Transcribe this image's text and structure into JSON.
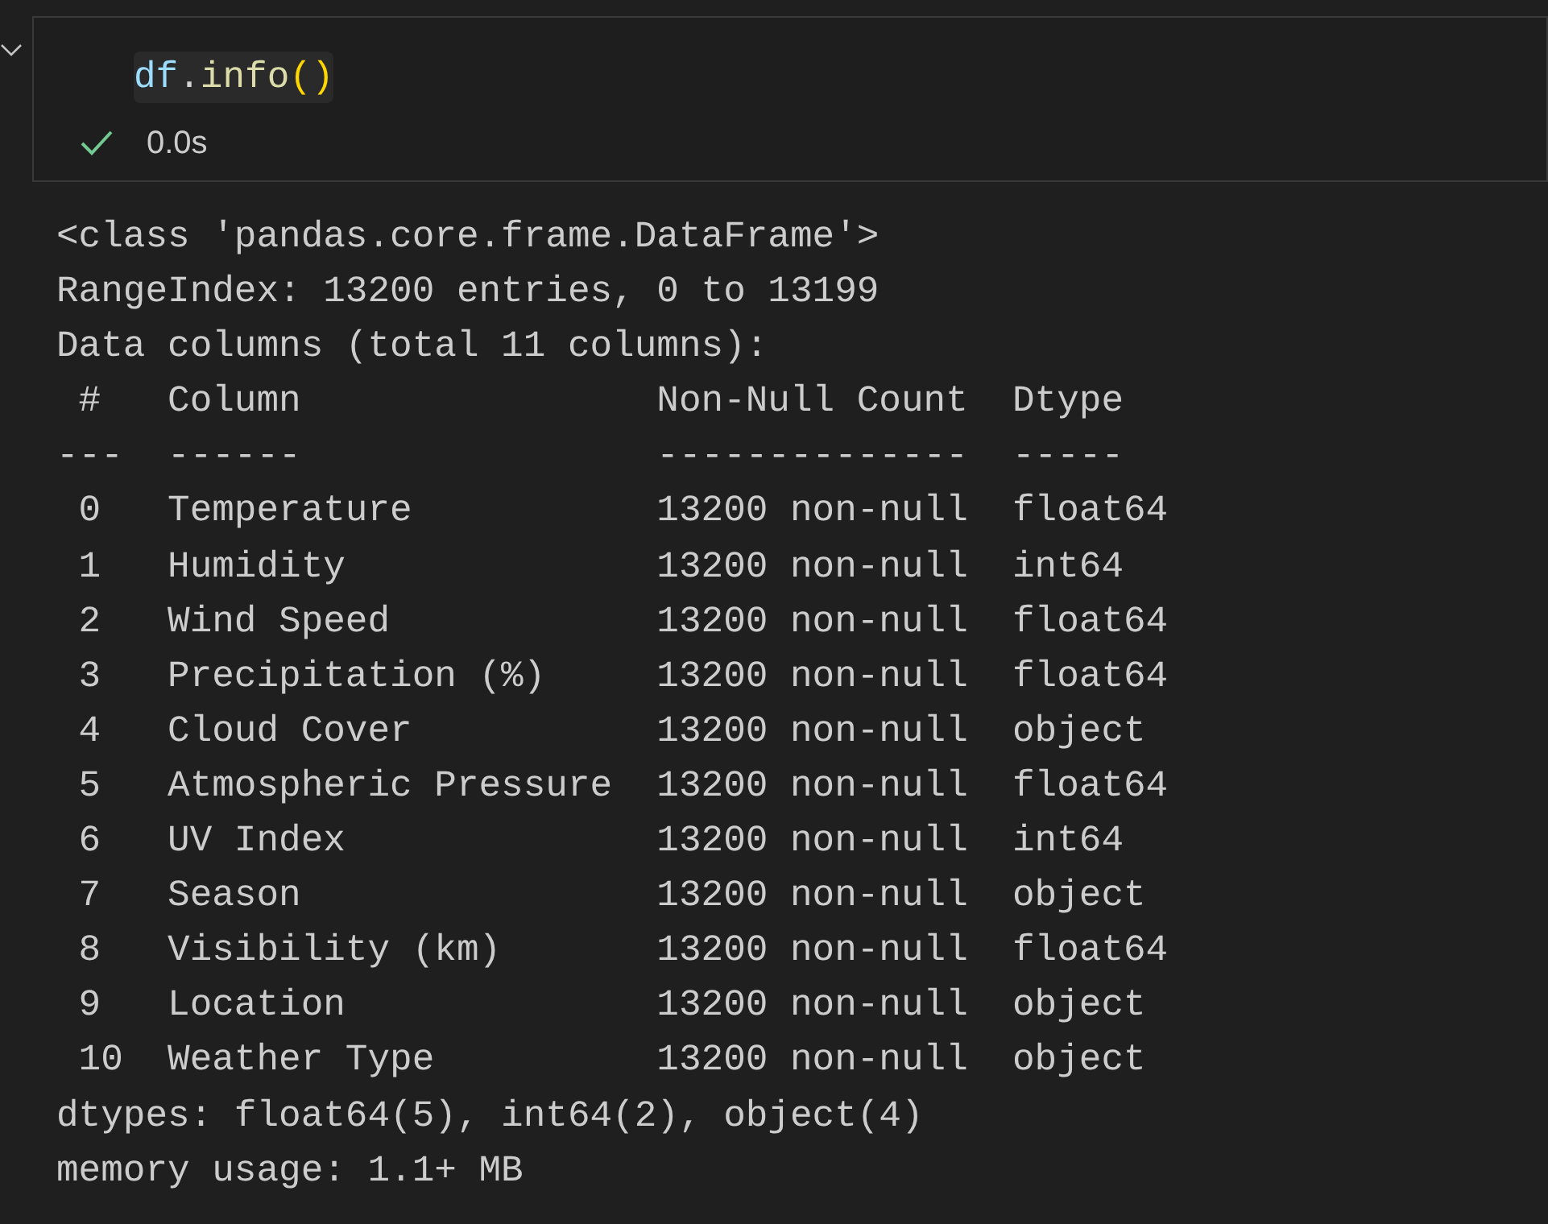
{
  "cell": {
    "expanded": true,
    "code": [
      {
        "kind": "name",
        "text": "df"
      },
      {
        "kind": "punct",
        "text": "."
      },
      {
        "kind": "call",
        "text": "info"
      },
      {
        "kind": "paren",
        "text": "()"
      }
    ],
    "status": {
      "kind": "success",
      "time": "0.0s"
    }
  },
  "output": {
    "lines": [
      "<class 'pandas.core.frame.DataFrame'>",
      "RangeIndex: 13200 entries, 0 to 13199",
      "Data columns (total 11 columns):",
      " #   Column                Non-Null Count  Dtype  ",
      "---  ------                --------------  -----  ",
      " 0   Temperature           13200 non-null  float64",
      " 1   Humidity              13200 non-null  int64  ",
      " 2   Wind Speed            13200 non-null  float64",
      " 3   Precipitation (%)     13200 non-null  float64",
      " 4   Cloud Cover           13200 non-null  object ",
      " 5   Atmospheric Pressure  13200 non-null  float64",
      " 6   UV Index              13200 non-null  int64  ",
      " 7   Season                13200 non-null  object ",
      " 8   Visibility (km)       13200 non-null  float64",
      " 9   Location              13200 non-null  object ",
      " 10  Weather Type          13200 non-null  object ",
      "dtypes: float64(5), int64(2), object(4)",
      "memory usage: 1.1+ MB"
    ]
  }
}
